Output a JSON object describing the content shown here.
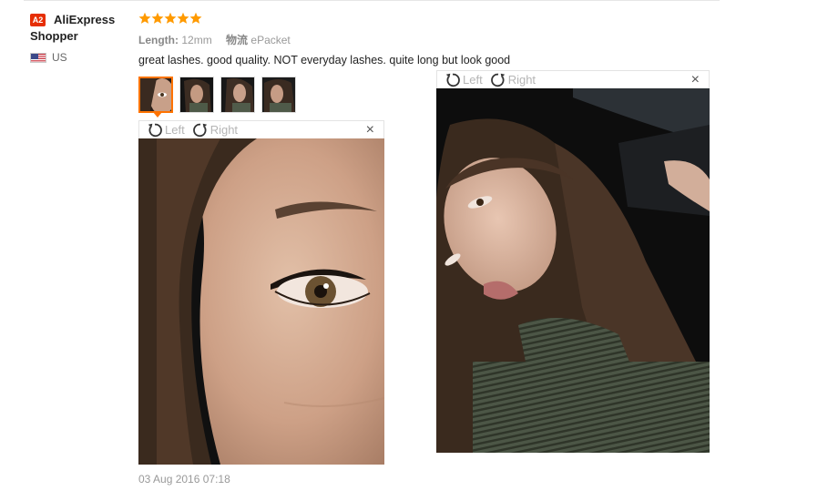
{
  "buyer": {
    "level": "A2",
    "name_line1": "AliExpress",
    "name_line2": "Shopper",
    "country": "US"
  },
  "review": {
    "rating": 5,
    "attributes": [
      {
        "key": "Length:",
        "value": "12mm"
      },
      {
        "key": "物流",
        "value": "ePacket"
      }
    ],
    "text": "great lashes. good quality. NOT everyday lashes. quite long but look good",
    "date": "03 Aug 2016 07:18",
    "thumbnails": 4,
    "active_thumbnail": 1
  },
  "viewer1": {
    "rotate_left": "Left",
    "rotate_right": "Right",
    "close": "×"
  },
  "viewer2": {
    "rotate_left": "Left",
    "rotate_right": "Right",
    "close": "×"
  },
  "colors": {
    "accent": "#ff7300",
    "star": "#ff9a00",
    "badge": "#e62e04"
  }
}
